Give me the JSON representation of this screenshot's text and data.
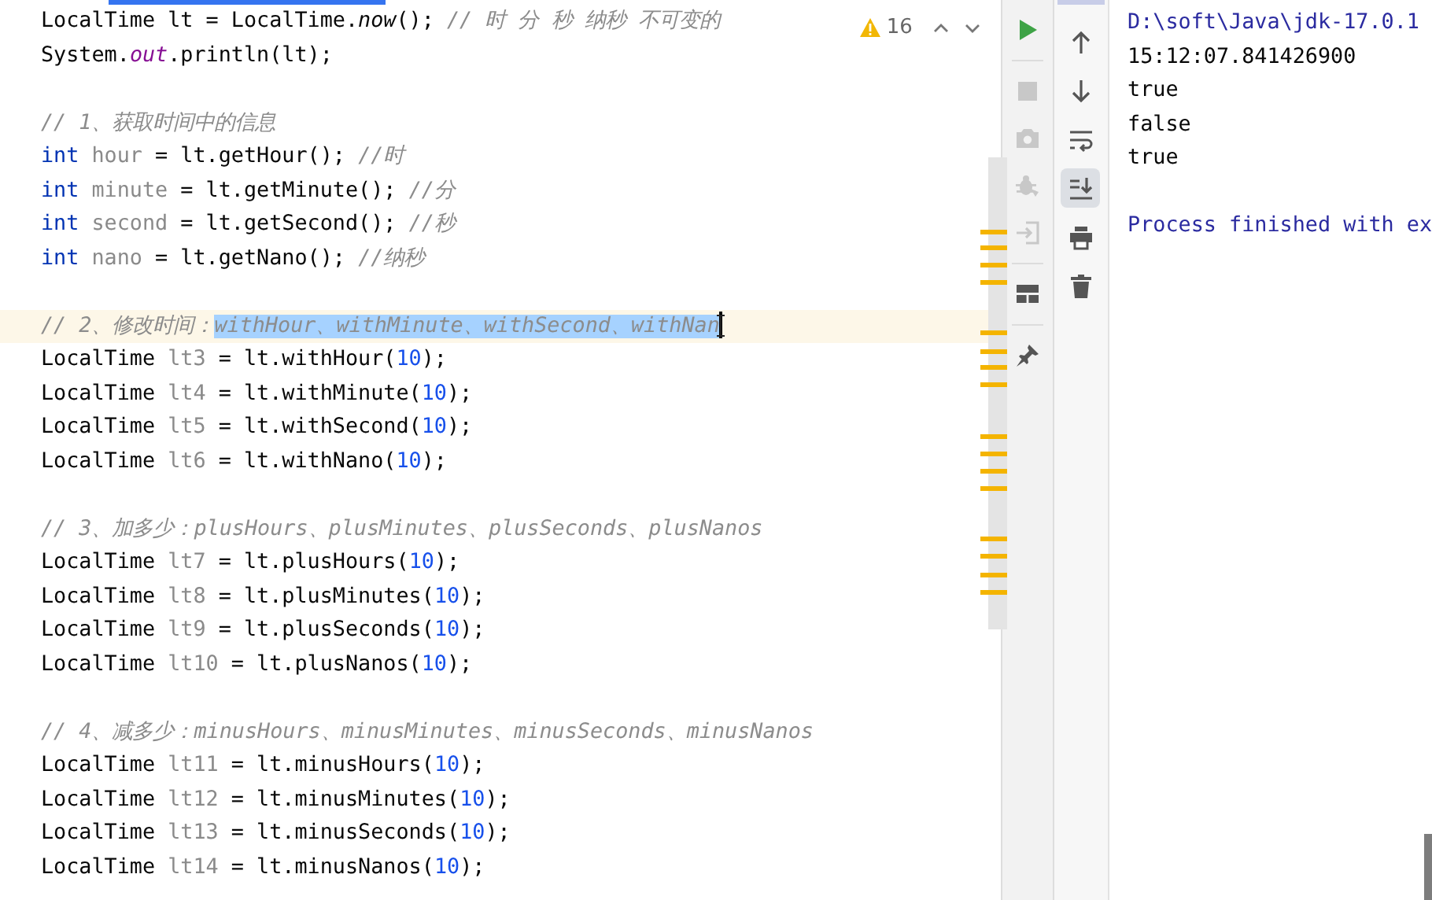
{
  "editor": {
    "warning_count": "16",
    "lines": [
      {
        "kind": "code",
        "current": false,
        "tokens": [
          {
            "kind": "code",
            "text": "LocalTime lt = LocalTime."
          },
          {
            "kind": "static",
            "text": "now"
          },
          {
            "kind": "code",
            "text": "(); "
          },
          {
            "kind": "comment",
            "text": "// 时 分 秒 纳秒 不可变的"
          }
        ]
      },
      {
        "kind": "code",
        "current": false,
        "tokens": [
          {
            "kind": "code",
            "text": "System."
          },
          {
            "kind": "field",
            "text": "out"
          },
          {
            "kind": "code",
            "text": ".println(lt);"
          }
        ]
      },
      {
        "kind": "blank",
        "current": false
      },
      {
        "kind": "code",
        "current": false,
        "tokens": [
          {
            "kind": "comment",
            "text": "// 1、获取时间中的信息"
          }
        ]
      },
      {
        "kind": "code",
        "current": false,
        "tokens": [
          {
            "kind": "keyword",
            "text": "int "
          },
          {
            "kind": "local",
            "text": "hour"
          },
          {
            "kind": "code",
            "text": " = lt.getHour(); "
          },
          {
            "kind": "comment",
            "text": "//时"
          }
        ]
      },
      {
        "kind": "code",
        "current": false,
        "tokens": [
          {
            "kind": "keyword",
            "text": "int "
          },
          {
            "kind": "local",
            "text": "minute"
          },
          {
            "kind": "code",
            "text": " = lt.getMinute(); "
          },
          {
            "kind": "comment",
            "text": "//分"
          }
        ]
      },
      {
        "kind": "code",
        "current": false,
        "tokens": [
          {
            "kind": "keyword",
            "text": "int "
          },
          {
            "kind": "local",
            "text": "second"
          },
          {
            "kind": "code",
            "text": " = lt.getSecond(); "
          },
          {
            "kind": "comment",
            "text": "//秒"
          }
        ]
      },
      {
        "kind": "code",
        "current": false,
        "tokens": [
          {
            "kind": "keyword",
            "text": "int "
          },
          {
            "kind": "local",
            "text": "nano"
          },
          {
            "kind": "code",
            "text": " = lt.getNano(); "
          },
          {
            "kind": "comment",
            "text": "//纳秒"
          }
        ]
      },
      {
        "kind": "blank",
        "current": false
      },
      {
        "kind": "code",
        "current": true,
        "tokens": [
          {
            "kind": "comment",
            "text": "// 2、修改时间："
          },
          {
            "kind": "selection",
            "text": "withHour、withMinute、withSecond、withNan"
          }
        ]
      },
      {
        "kind": "code",
        "current": false,
        "tokens": [
          {
            "kind": "code",
            "text": "LocalTime "
          },
          {
            "kind": "local",
            "text": "lt3"
          },
          {
            "kind": "code",
            "text": " = lt.withHour("
          },
          {
            "kind": "number",
            "text": "10"
          },
          {
            "kind": "code",
            "text": ");"
          }
        ]
      },
      {
        "kind": "code",
        "current": false,
        "tokens": [
          {
            "kind": "code",
            "text": "LocalTime "
          },
          {
            "kind": "local",
            "text": "lt4"
          },
          {
            "kind": "code",
            "text": " = lt.withMinute("
          },
          {
            "kind": "number",
            "text": "10"
          },
          {
            "kind": "code",
            "text": ");"
          }
        ]
      },
      {
        "kind": "code",
        "current": false,
        "tokens": [
          {
            "kind": "code",
            "text": "LocalTime "
          },
          {
            "kind": "local",
            "text": "lt5"
          },
          {
            "kind": "code",
            "text": " = lt.withSecond("
          },
          {
            "kind": "number",
            "text": "10"
          },
          {
            "kind": "code",
            "text": ");"
          }
        ]
      },
      {
        "kind": "code",
        "current": false,
        "tokens": [
          {
            "kind": "code",
            "text": "LocalTime "
          },
          {
            "kind": "local",
            "text": "lt6"
          },
          {
            "kind": "code",
            "text": " = lt.withNano("
          },
          {
            "kind": "number",
            "text": "10"
          },
          {
            "kind": "code",
            "text": ");"
          }
        ]
      },
      {
        "kind": "blank",
        "current": false
      },
      {
        "kind": "code",
        "current": false,
        "tokens": [
          {
            "kind": "comment",
            "text": "// 3、加多少：plusHours、plusMinutes、plusSeconds、plusNanos"
          }
        ]
      },
      {
        "kind": "code",
        "current": false,
        "tokens": [
          {
            "kind": "code",
            "text": "LocalTime "
          },
          {
            "kind": "local",
            "text": "lt7"
          },
          {
            "kind": "code",
            "text": " = lt.plusHours("
          },
          {
            "kind": "number",
            "text": "10"
          },
          {
            "kind": "code",
            "text": ");"
          }
        ]
      },
      {
        "kind": "code",
        "current": false,
        "tokens": [
          {
            "kind": "code",
            "text": "LocalTime "
          },
          {
            "kind": "local",
            "text": "lt8"
          },
          {
            "kind": "code",
            "text": " = lt.plusMinutes("
          },
          {
            "kind": "number",
            "text": "10"
          },
          {
            "kind": "code",
            "text": ");"
          }
        ]
      },
      {
        "kind": "code",
        "current": false,
        "tokens": [
          {
            "kind": "code",
            "text": "LocalTime "
          },
          {
            "kind": "local",
            "text": "lt9"
          },
          {
            "kind": "code",
            "text": " = lt.plusSeconds("
          },
          {
            "kind": "number",
            "text": "10"
          },
          {
            "kind": "code",
            "text": ");"
          }
        ]
      },
      {
        "kind": "code",
        "current": false,
        "tokens": [
          {
            "kind": "code",
            "text": "LocalTime "
          },
          {
            "kind": "local",
            "text": "lt10"
          },
          {
            "kind": "code",
            "text": " = lt.plusNanos("
          },
          {
            "kind": "number",
            "text": "10"
          },
          {
            "kind": "code",
            "text": ");"
          }
        ]
      },
      {
        "kind": "blank",
        "current": false
      },
      {
        "kind": "code",
        "current": false,
        "tokens": [
          {
            "kind": "comment",
            "text": "// 4、减多少：minusHours、minusMinutes、minusSeconds、minusNanos"
          }
        ]
      },
      {
        "kind": "code",
        "current": false,
        "tokens": [
          {
            "kind": "code",
            "text": "LocalTime "
          },
          {
            "kind": "local",
            "text": "lt11"
          },
          {
            "kind": "code",
            "text": " = lt.minusHours("
          },
          {
            "kind": "number",
            "text": "10"
          },
          {
            "kind": "code",
            "text": ");"
          }
        ]
      },
      {
        "kind": "code",
        "current": false,
        "tokens": [
          {
            "kind": "code",
            "text": "LocalTime "
          },
          {
            "kind": "local",
            "text": "lt12"
          },
          {
            "kind": "code",
            "text": " = lt.minusMinutes("
          },
          {
            "kind": "number",
            "text": "10"
          },
          {
            "kind": "code",
            "text": ");"
          }
        ]
      },
      {
        "kind": "code",
        "current": false,
        "tokens": [
          {
            "kind": "code",
            "text": "LocalTime "
          },
          {
            "kind": "local",
            "text": "lt13"
          },
          {
            "kind": "code",
            "text": " = lt.minusSeconds("
          },
          {
            "kind": "number",
            "text": "10"
          },
          {
            "kind": "code",
            "text": ");"
          }
        ]
      },
      {
        "kind": "code",
        "current": false,
        "tokens": [
          {
            "kind": "code",
            "text": "LocalTime "
          },
          {
            "kind": "local",
            "text": "lt14"
          },
          {
            "kind": "code",
            "text": " = lt.minusNanos("
          },
          {
            "kind": "number",
            "text": "10"
          },
          {
            "kind": "code",
            "text": ");"
          }
        ]
      }
    ]
  },
  "run_toolbar": [
    {
      "kind": "run",
      "disabled": false
    },
    {
      "kind": "stop",
      "disabled": true
    },
    {
      "kind": "camera",
      "disabled": true
    },
    {
      "kind": "bug",
      "disabled": true
    },
    {
      "kind": "login",
      "disabled": true
    },
    {
      "kind": "layout",
      "disabled": false
    },
    {
      "kind": "pin",
      "disabled": false
    }
  ],
  "console_toolbar": [
    {
      "kind": "up",
      "selected": false
    },
    {
      "kind": "down",
      "selected": false
    },
    {
      "kind": "wrap",
      "selected": false
    },
    {
      "kind": "scroll-end",
      "selected": true
    },
    {
      "kind": "print",
      "selected": false
    },
    {
      "kind": "trash",
      "selected": false
    }
  ],
  "console": [
    {
      "kind": "system",
      "text": "D:\\soft\\Java\\jdk-17.0.1"
    },
    {
      "kind": "output",
      "text": "15:12:07.841426900"
    },
    {
      "kind": "output",
      "text": "true"
    },
    {
      "kind": "output",
      "text": "false"
    },
    {
      "kind": "output",
      "text": "true"
    },
    {
      "kind": "blank"
    },
    {
      "kind": "system",
      "text": "Process finished with ex"
    }
  ]
}
